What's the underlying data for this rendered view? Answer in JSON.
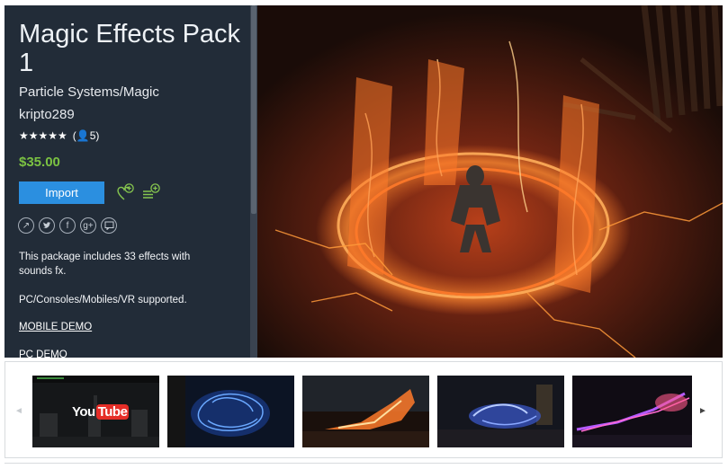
{
  "asset": {
    "title": "Magic Effects Pack 1",
    "category": "Particle Systems/Magic",
    "publisher": "kripto289",
    "stars": "★★★★★",
    "rating_count": "(👤5)",
    "price": "$35.00",
    "import_label": "Import"
  },
  "share_icons": [
    "external-link-icon",
    "twitter-icon",
    "facebook-icon",
    "google-plus-icon",
    "comment-icon"
  ],
  "description": {
    "line1": "This package includes 33 effects with sounds fx.",
    "line2": "PC/Consoles/Mobiles/VR supported.",
    "link1": "MOBILE DEMO",
    "link2": "PC DEMO"
  },
  "gallery": {
    "prev_arrow": "◄",
    "next_arrow": "►",
    "thumbnails": [
      {
        "kind": "video",
        "label": "YouTube"
      },
      {
        "kind": "image",
        "label": ""
      },
      {
        "kind": "image",
        "label": ""
      },
      {
        "kind": "image",
        "label": ""
      },
      {
        "kind": "image",
        "label": ""
      }
    ]
  },
  "colors": {
    "sidebar_bg": "#222c38",
    "price_green": "#7bc242",
    "import_blue": "#2b8fe0",
    "youtube_red": "#e52d27"
  }
}
